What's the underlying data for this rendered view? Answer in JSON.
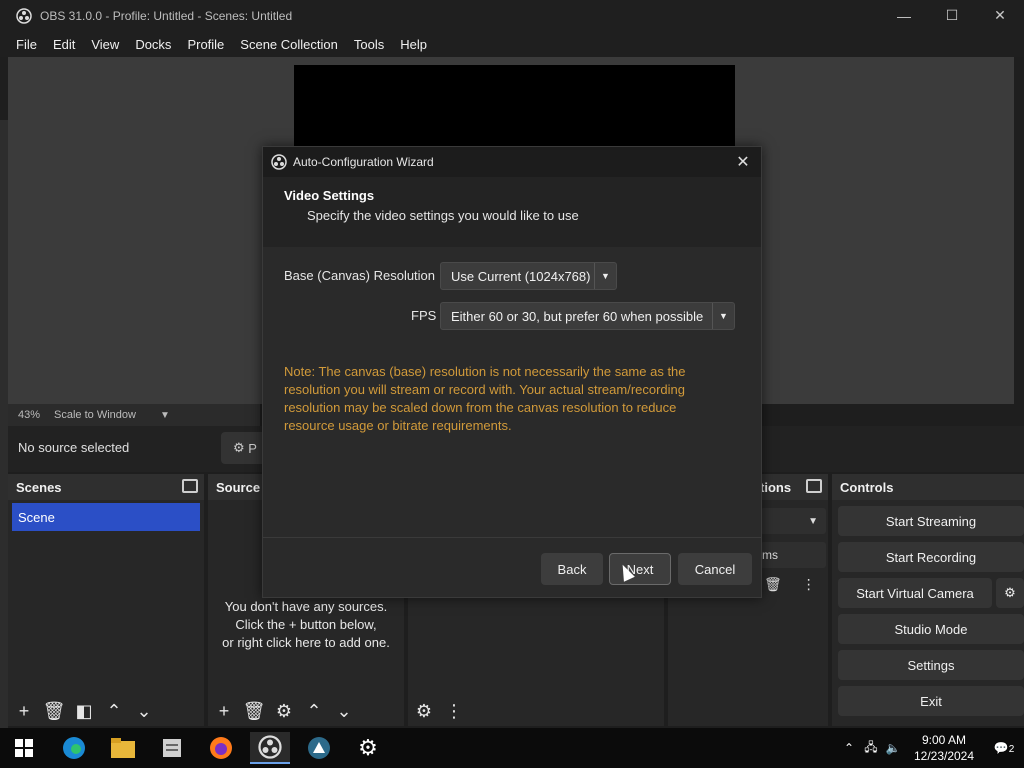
{
  "window": {
    "title": "OBS 31.0.0 - Profile: Untitled - Scenes: Untitled",
    "minimize": "—",
    "maximize": "☐",
    "close": "✕"
  },
  "menu": [
    "File",
    "Edit",
    "View",
    "Docks",
    "Profile",
    "Scene Collection",
    "Tools",
    "Help"
  ],
  "preview": {
    "zoom": "43%",
    "scale_mode": "Scale to Window"
  },
  "source_bar": {
    "status": "No source selected",
    "properties_label": "P"
  },
  "docks": {
    "scenes": {
      "title": "Scenes",
      "items": [
        "Scene"
      ]
    },
    "sources": {
      "title": "Source",
      "empty_lines": [
        "You don't have any sources.",
        "Click the + button below,",
        "or right click here to add one."
      ]
    },
    "transitions": {
      "title": "tions",
      "duration_unit": "ms"
    },
    "controls": {
      "title": "Controls",
      "buttons": [
        "Start Streaming",
        "Start Recording",
        "Start Virtual Camera",
        "Studio Mode",
        "Settings",
        "Exit"
      ]
    }
  },
  "dialog": {
    "title": "Auto-Configuration Wizard",
    "heading": "Video Settings",
    "subheading": "Specify the video settings you would like to use",
    "resolution_label": "Base (Canvas) Resolution",
    "resolution_value": "Use Current (1024x768)",
    "fps_label": "FPS",
    "fps_value": "Either 60 or 30, but prefer 60 when possible",
    "note": "Note: The canvas (base) resolution is not necessarily the same as the resolution you will stream or record with. Your actual stream/recording resolution may be scaled down from the canvas resolution to reduce resource usage or bitrate requirements.",
    "buttons": {
      "back": "Back",
      "next": "Next",
      "cancel": "Cancel"
    }
  },
  "taskbar": {
    "time": "9:00 AM",
    "date": "12/23/2024",
    "notification_count": "2"
  },
  "colors": {
    "accent": "#2b4fc6",
    "note": "#d19a3a"
  }
}
